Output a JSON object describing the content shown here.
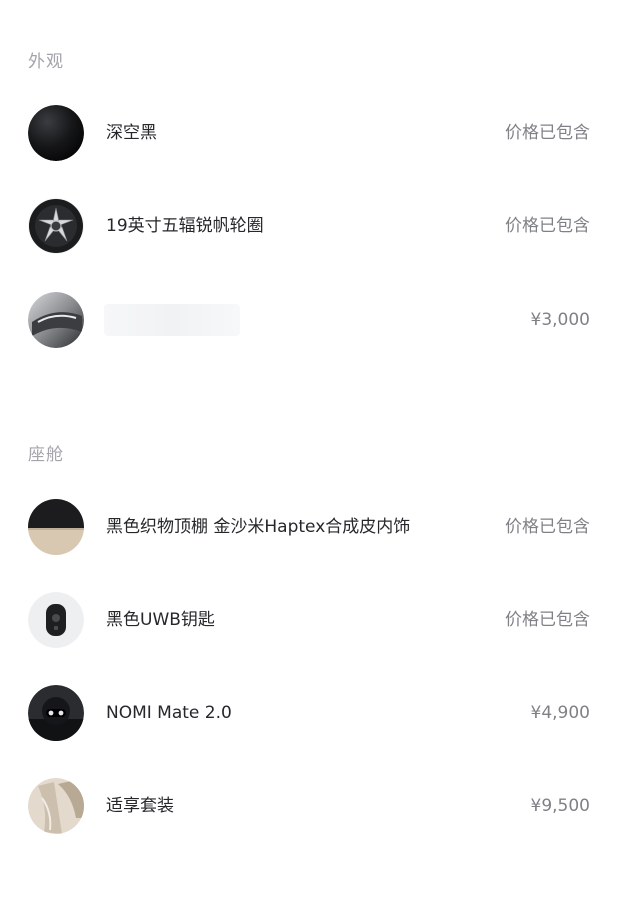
{
  "exterior": {
    "title": "外观",
    "items": [
      {
        "icon": "black-paint-swatch-icon",
        "name": "深空黑",
        "price": "价格已包含"
      },
      {
        "icon": "wheel-rim-icon",
        "name": "19英寸五辐锐帆轮圈",
        "price": "价格已包含"
      },
      {
        "icon": "sunroof-icon",
        "name": "",
        "price": "¥3,000"
      }
    ]
  },
  "cabin": {
    "title": "座舱",
    "items": [
      {
        "icon": "interior-trim-swatch-icon",
        "name": "黑色织物顶棚 金沙米Haptex合成皮内饰",
        "price": "价格已包含"
      },
      {
        "icon": "uwb-key-icon",
        "name": "黑色UWB钥匙",
        "price": "价格已包含"
      },
      {
        "icon": "nomi-mate-icon",
        "name": "NOMI Mate 2.0",
        "price": "¥4,900"
      },
      {
        "icon": "comfort-seat-icon",
        "name": "适享套装",
        "price": "¥9,500"
      }
    ]
  }
}
